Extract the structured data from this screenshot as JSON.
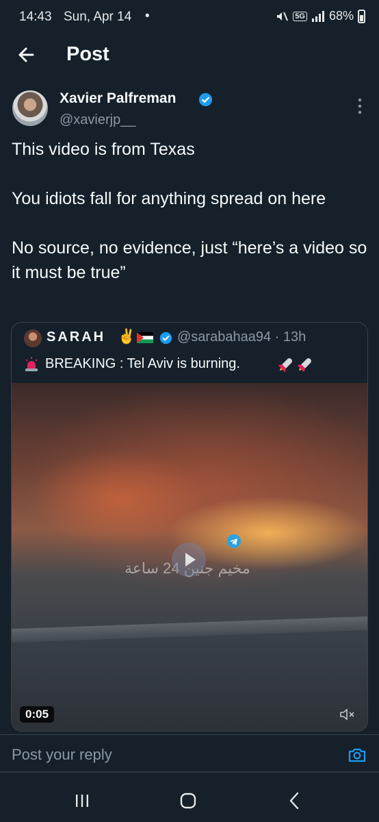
{
  "status_bar": {
    "time": "14:43",
    "date": "Sun, Apr 14",
    "dot": "•",
    "network": "5G",
    "battery": "68%"
  },
  "header": {
    "title": "Post",
    "back_icon": "arrow-left-icon"
  },
  "post": {
    "author_name": "Xavier Palfreman",
    "author_handle": "@xavierjp__",
    "verified": true,
    "paragraphs": [
      "This video is from Texas",
      "You idiots fall for anything spread on here",
      "No source, no evidence, just “here’s a video so it must be true”"
    ]
  },
  "quote": {
    "author_name": "SARAH",
    "author_emoji": "✌️",
    "handle_time": "@sarabahaa94 · 13h",
    "text": "BREAKING : Tel Aviv is burning.",
    "watermark": "مخيم جنين 24 ساعة",
    "video_duration": "0:05"
  },
  "reply": {
    "placeholder": "Post your reply"
  },
  "colors": {
    "background": "#15202b",
    "accent": "#1d9bf0",
    "muted": "#8b98a5",
    "border": "#38444d"
  }
}
